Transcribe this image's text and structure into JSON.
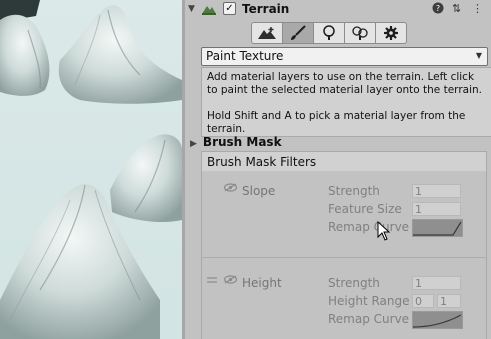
{
  "inspector": {
    "component_title": "Terrain",
    "enabled_mark": "✓",
    "header_icons": {
      "help": "?",
      "presets": "⇅",
      "menu": "⋮"
    },
    "tool_icons": [
      "raise-terrain-icon",
      "paint-brush-icon",
      "paint-trees-icon",
      "paint-details-icon",
      "settings-gear-icon"
    ],
    "tool_active_index": 1,
    "tool_dropdown": {
      "selected": "Paint Texture"
    },
    "help_text": {
      "line1": "Add material layers to use on the terrain. Left click to paint the selected material layer onto the terrain.",
      "line2": "Hold Shift and A to pick a material layer from the terrain."
    },
    "brush_mask": {
      "title": "Brush Mask",
      "filters_title": "Brush Mask Filters",
      "filters": [
        {
          "name": "Slope",
          "strength_label": "Strength",
          "strength_value": "1",
          "param_label": "Feature Size",
          "param_value": "1",
          "curve_label": "Remap Curve"
        },
        {
          "name": "Height",
          "strength_label": "Strength",
          "strength_value": "1",
          "param_label": "Height Range",
          "range_min": "0",
          "range_max": "1",
          "curve_label": "Remap Curve"
        }
      ]
    }
  },
  "colors": {
    "accent": "#3c7bd1",
    "inspector_bg": "#c2c2c2",
    "scene_sky": "#cfe3e2"
  }
}
